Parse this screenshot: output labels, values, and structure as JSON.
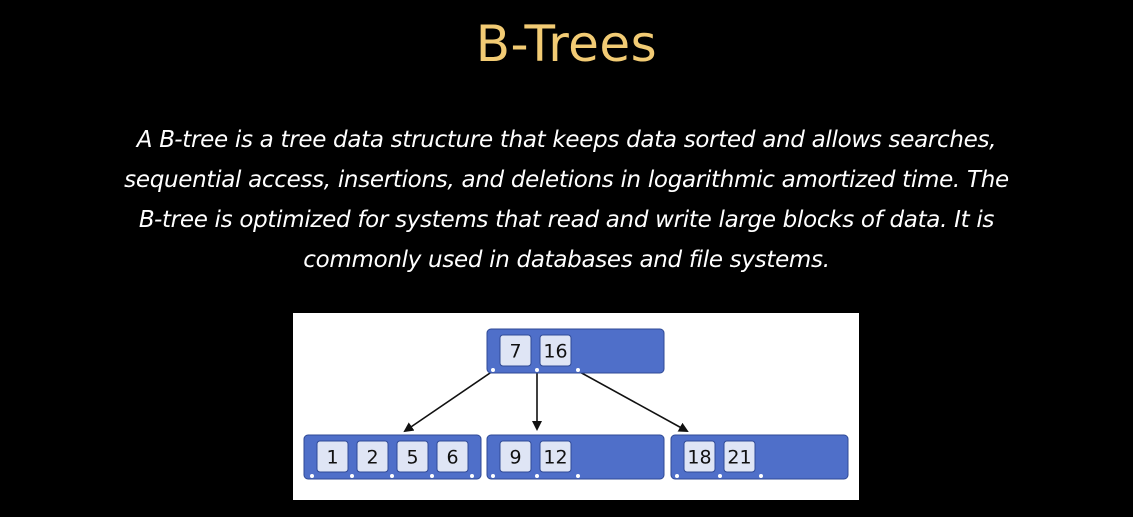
{
  "slide": {
    "title": "B-Trees",
    "body_lines": [
      "A B-tree is a tree data structure that keeps data sorted and allows searches,",
      "sequential access, insertions, and deletions in logarithmic amortized time. The",
      "B-tree is optimized for systems that read and write large blocks of data.  It is",
      "commonly used in databases and file systems."
    ]
  },
  "diagram": {
    "root": {
      "keys": [
        "7",
        "16"
      ]
    },
    "children": [
      {
        "keys": [
          "1",
          "2",
          "5",
          "6"
        ]
      },
      {
        "keys": [
          "9",
          "12"
        ]
      },
      {
        "keys": [
          "18",
          "21"
        ]
      }
    ],
    "colors": {
      "node_fill": "#4f6fc9",
      "key_fill": "#dfe5f5",
      "title": "#f2cb74"
    }
  }
}
